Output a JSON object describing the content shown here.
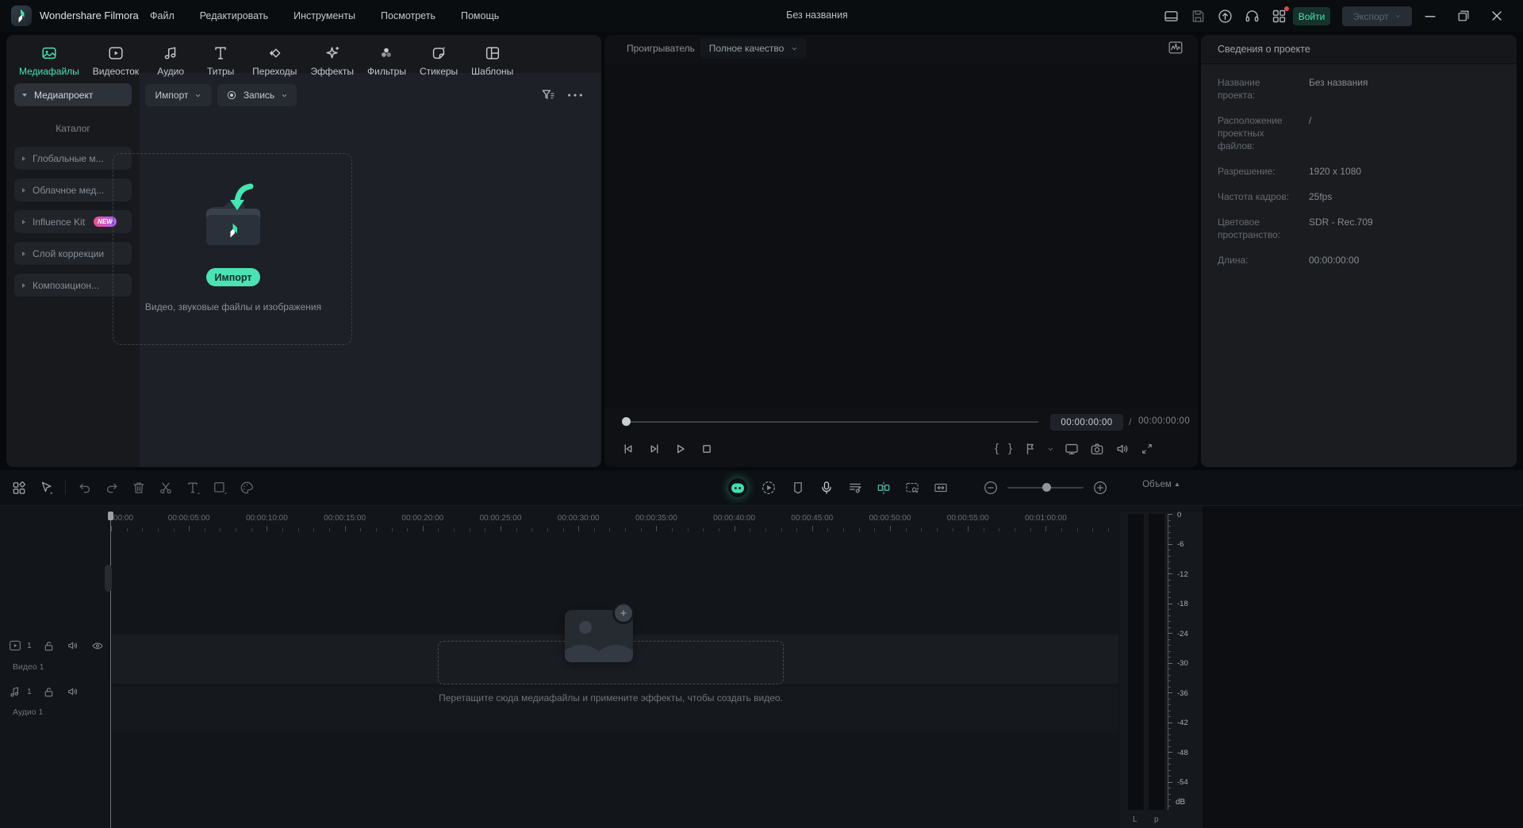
{
  "colors": {
    "accent": "#4be3b4",
    "badge_gradient_from": "#f0508e",
    "badge_gradient_to": "#a55ef5",
    "notification_dot": "#e0474c",
    "panel_bg": "#17191d"
  },
  "titlebar": {
    "app_name": "Wondershare Filmora",
    "menus": [
      "Файл",
      "Редактировать",
      "Инструменты",
      "Посмотреть",
      "Помощь"
    ],
    "document_title": "Без названия",
    "login_label": "Войти",
    "export_label": "Экспорт"
  },
  "media_panel": {
    "tabs": [
      {
        "label": "Медиафайлы",
        "active": true
      },
      {
        "label": "Видеосток",
        "active": false
      },
      {
        "label": "Аудио",
        "active": false
      },
      {
        "label": "Титры",
        "active": false
      },
      {
        "label": "Переходы",
        "active": false
      },
      {
        "label": "Эффекты",
        "active": false
      },
      {
        "label": "Фильтры",
        "active": false
      },
      {
        "label": "Стикеры",
        "active": false
      },
      {
        "label": "Шаблоны",
        "active": false
      }
    ],
    "sidebar": {
      "project_item": "Медиапроект",
      "catalog_label": "Каталог",
      "items": [
        {
          "label": "Глобальные м..."
        },
        {
          "label": "Облачное мед..."
        },
        {
          "label": "Influence Kit",
          "badge": "NEW"
        },
        {
          "label": "Слой коррекции"
        },
        {
          "label": "Композицион..."
        }
      ]
    },
    "toolbar": {
      "import_label": "Импорт",
      "record_label": "Запись"
    },
    "dropzone": {
      "button_label": "Импорт",
      "caption": "Видео, звуковые файлы и изображения"
    }
  },
  "player": {
    "title": "Проигрыватель",
    "quality_selector": "Полное качество",
    "current_time": "00:00:00:00",
    "time_separator": "/",
    "total_time": "00:00:00:00"
  },
  "project_info": {
    "title": "Сведения о проекте",
    "rows": [
      {
        "label": "Название проекта:",
        "value": "Без названия"
      },
      {
        "label": "Расположение проектных файлов:",
        "value": "/"
      },
      {
        "label": "Разрешение:",
        "value": "1920 x 1080"
      },
      {
        "label": "Частота кадров:",
        "value": "25fps"
      },
      {
        "label": "Цветовое пространство:",
        "value": "SDR - Rec.709"
      },
      {
        "label": "Длина:",
        "value": "00:00:00:00"
      }
    ]
  },
  "timeline": {
    "volume_label": "Объем",
    "ruler_labels": [
      "00:00",
      "00:00:05:00",
      "00:00:10:00",
      "00:00:15:00",
      "00:00:20:00",
      "00:00:25:00",
      "00:00:30:00",
      "00:00:35:00",
      "00:00:40:00",
      "00:00:45:00",
      "00:00:50:00",
      "00:00:55:00",
      "00:01:00:00"
    ],
    "tracks": [
      {
        "label": "Видео 1",
        "count": "1"
      },
      {
        "label": "Аудио 1",
        "count": "1"
      }
    ],
    "dropzone_text": "Перетащите сюда медиафайлы и примените эффекты, чтобы создать видео.",
    "meter": {
      "tick_labels": [
        "0",
        "-6",
        "-12",
        "-18",
        "-24",
        "-30",
        "-36",
        "-42",
        "-48",
        "-54"
      ],
      "unit": "dB",
      "channel_labels": [
        "L",
        "p"
      ]
    }
  }
}
